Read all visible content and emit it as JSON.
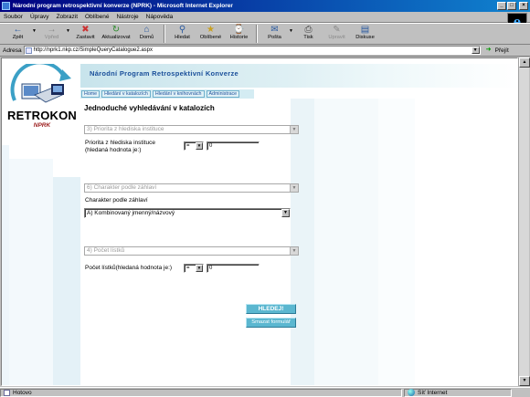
{
  "window": {
    "title": "Národní program retrospektivní konverze (NPRK) - Microsoft Internet Explorer",
    "controls": [
      "_",
      "□",
      "×"
    ]
  },
  "menu": {
    "items": [
      {
        "label": "Soubor"
      },
      {
        "label": "Úpravy"
      },
      {
        "label": "Zobrazit"
      },
      {
        "label": "Oblíbené"
      },
      {
        "label": "Nástroje"
      },
      {
        "label": "Nápověda"
      }
    ]
  },
  "toolbar": {
    "back": "Zpět",
    "forward": "Vpřed",
    "stop": "Zastavit",
    "refresh": "Aktualizovat",
    "home": "Domů",
    "search": "Hledat",
    "favorites": "Oblíbené",
    "history": "Historie",
    "mail": "Pošta",
    "print": "Tisk",
    "edit": "Upravit",
    "discuss": "Diskuse"
  },
  "address": {
    "label": "Adresa",
    "url": "http://nprk1.nkp.cz/SimpleQueryCatalogue2.aspx",
    "go": "Přejít"
  },
  "logo": {
    "word": "RETROKON",
    "sub": "NPRK"
  },
  "banner": {
    "title": "Národní Program Retrospektivní Konverze"
  },
  "nav": {
    "tabs": [
      {
        "label": "Home"
      },
      {
        "label": "Hledání v katalozích"
      },
      {
        "label": "Hledání v knihovnách"
      },
      {
        "label": "Administrace"
      }
    ]
  },
  "page": {
    "heading": "Jednoduché vyhledávání v katalozích"
  },
  "sections": {
    "priority": {
      "header": "3) Priorita z hlediska instituce",
      "label_line1": "Priorita z hlediska instituce",
      "label_line2": "(hledaná hodnota je:)",
      "operator": "=",
      "value": "0"
    },
    "character": {
      "header": "6) Charakter podle záhlaví",
      "label": "Charakter podle záhlaví",
      "selected": "A) Kombinovaný jmenný/názvový"
    },
    "count": {
      "header": "4) Počet lístků",
      "label": "Počet lístků(hledaná hodnota je:)",
      "operator": "=",
      "value": "0"
    }
  },
  "buttons": {
    "search": "HLEDEJ!",
    "clear": "Smazat formulář"
  },
  "status": {
    "text": "Hotovo",
    "zone": "Síť Internet"
  },
  "colors": {
    "accent": "#5bb7d0",
    "banner_text": "#1a4f9a",
    "titlebar": "#000080"
  }
}
